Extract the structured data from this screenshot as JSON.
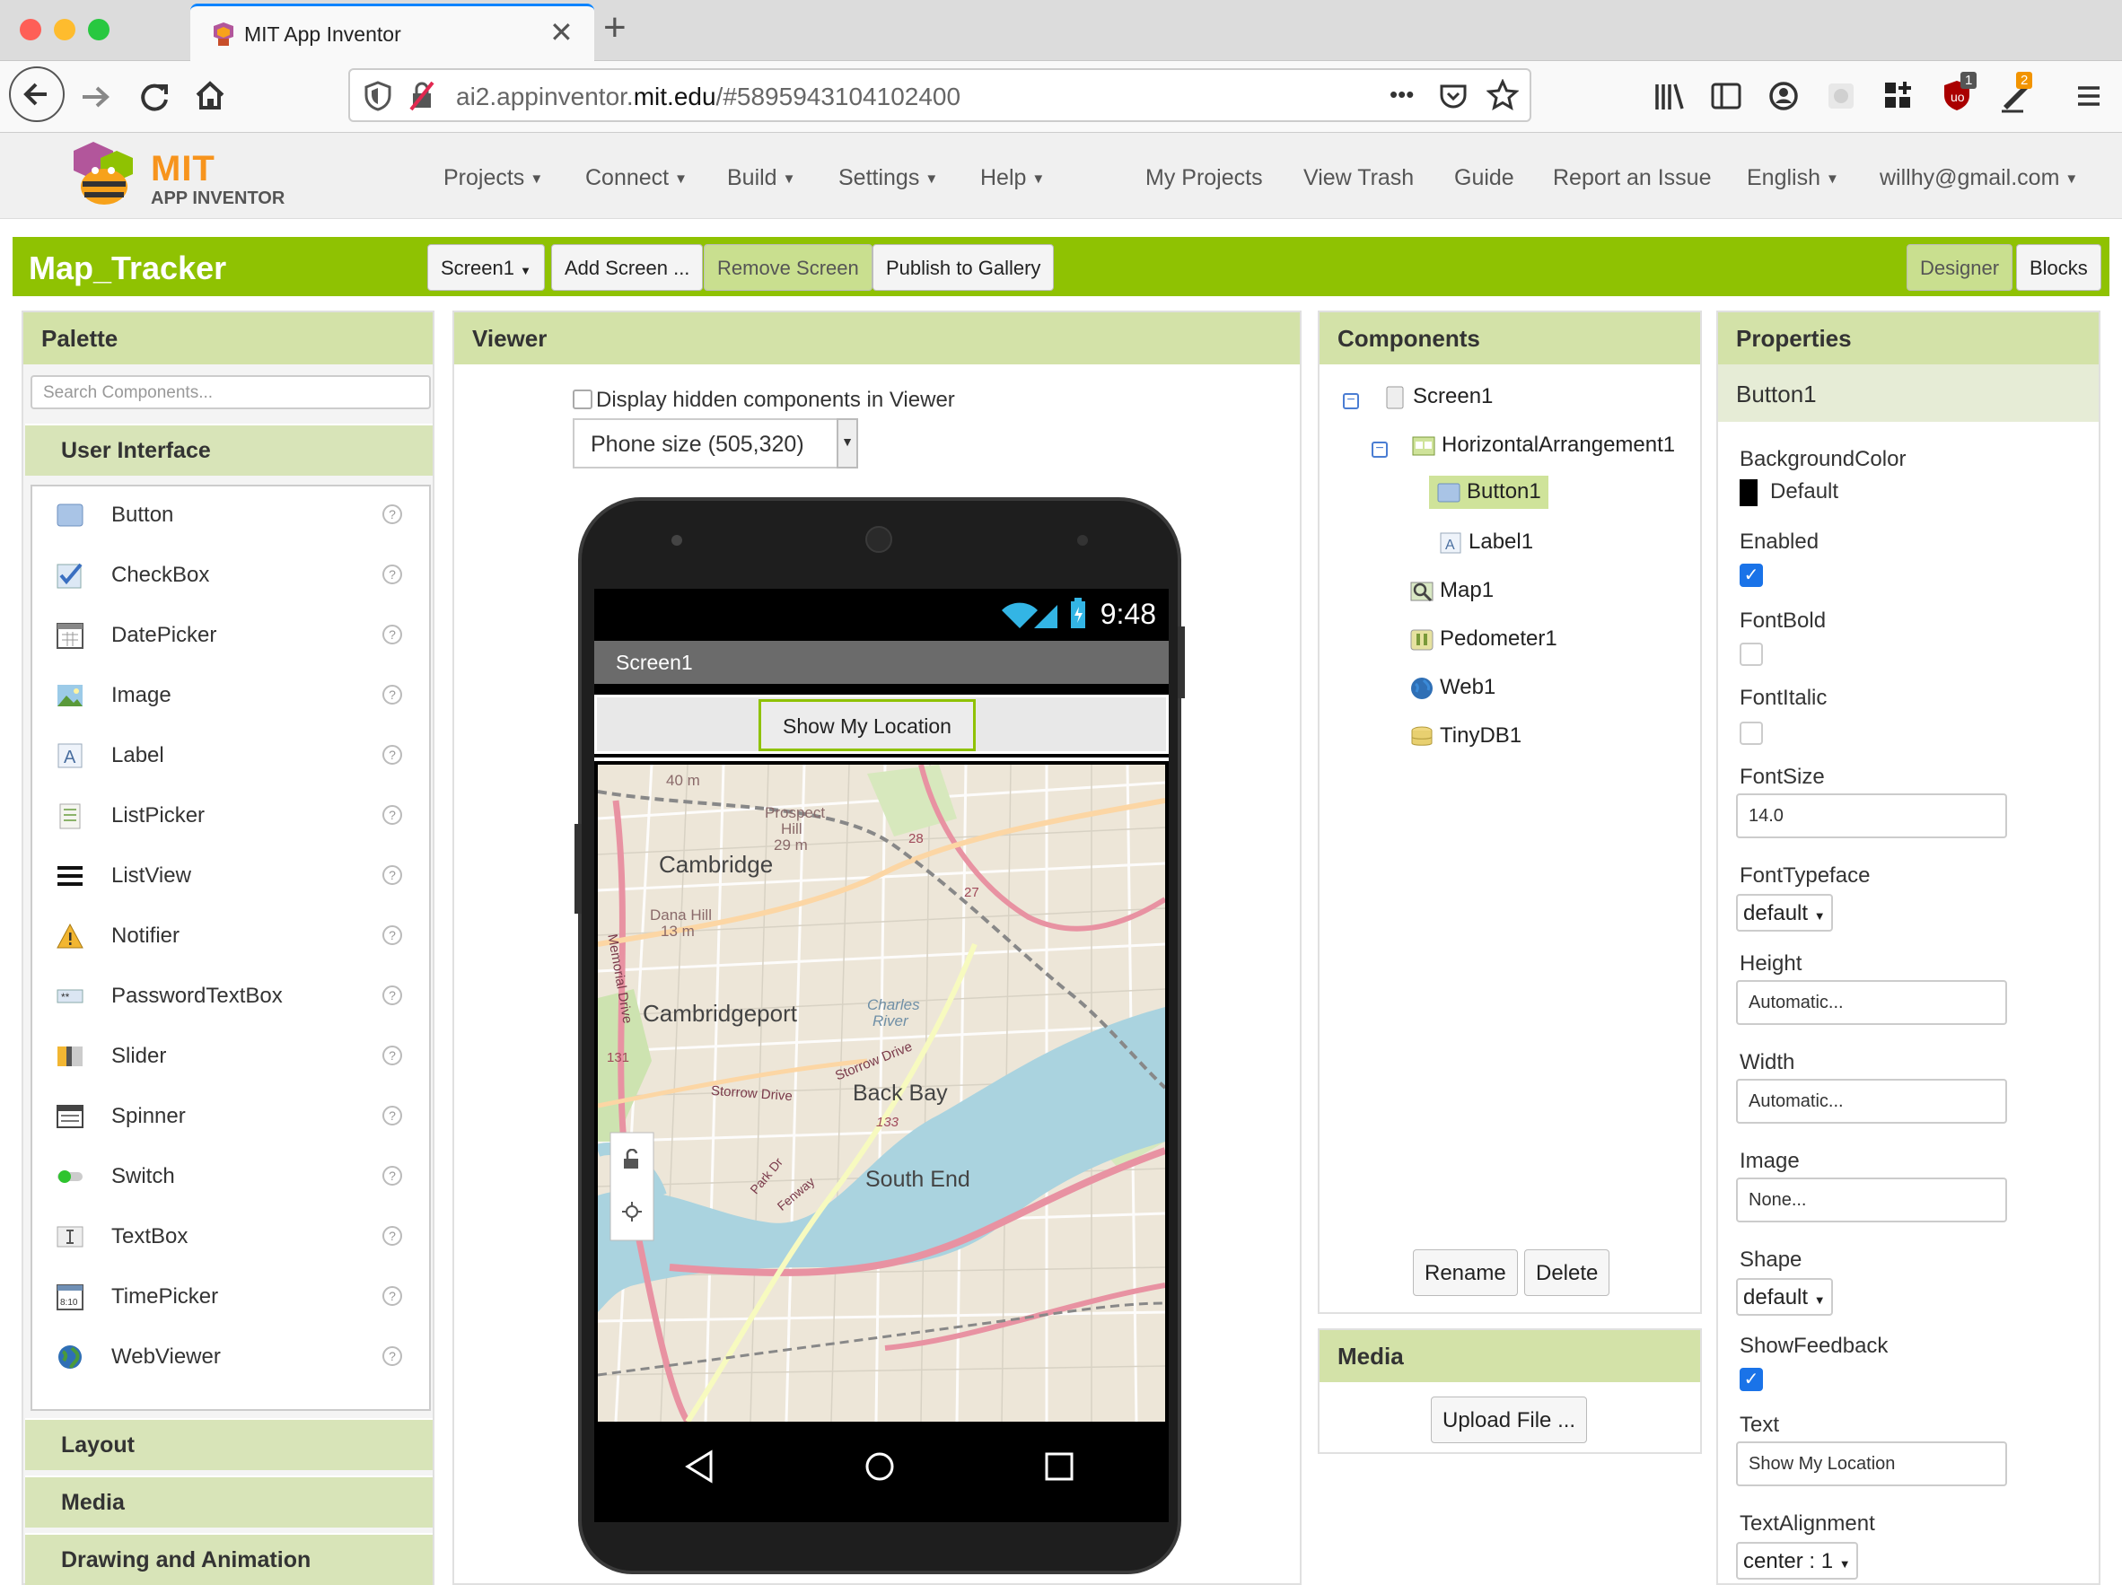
{
  "browser": {
    "tab_title": "MIT App Inventor",
    "url_prefix": "ai2.appinventor.",
    "url_host": "mit.edu",
    "url_path": "/#5895943104102400",
    "url_dots": "•••",
    "badge_1": "1",
    "badge_2": "2"
  },
  "header": {
    "logo_mit": "MIT",
    "logo_sub": "APP INVENTOR",
    "menus": [
      "Projects",
      "Connect",
      "Build",
      "Settings",
      "Help"
    ],
    "links": [
      "My Projects",
      "View Trash",
      "Guide",
      "Report an Issue"
    ],
    "language": "English",
    "user": "willhy@gmail.com"
  },
  "project": {
    "name": "Map_Tracker",
    "screen_select": "Screen1",
    "add_screen": "Add Screen ...",
    "remove_screen": "Remove Screen",
    "publish": "Publish to Gallery",
    "designer": "Designer",
    "blocks": "Blocks"
  },
  "palette": {
    "title": "Palette",
    "search_placeholder": "Search Components...",
    "category_open": "User Interface",
    "items": [
      "Button",
      "CheckBox",
      "DatePicker",
      "Image",
      "Label",
      "ListPicker",
      "ListView",
      "Notifier",
      "PasswordTextBox",
      "Slider",
      "Spinner",
      "Switch",
      "TextBox",
      "TimePicker",
      "WebViewer"
    ],
    "help": "?",
    "categories_closed": [
      "Layout",
      "Media",
      "Drawing and Animation"
    ]
  },
  "viewer": {
    "title": "Viewer",
    "hidden_label": "Display hidden components in Viewer",
    "phone_size": "Phone size (505,320)",
    "time": "9:48",
    "screen_title": "Screen1",
    "button_text": "Show My Location",
    "map_labels": {
      "cambridge": "Cambridge",
      "cambridgeport": "Cambridgeport",
      "back_bay": "Back Bay",
      "south_end": "South End",
      "prospect_hill": "Prospect",
      "prospect_hill2": "Hill",
      "prospect_m": "29 m",
      "dana_hill": "Dana Hill",
      "dana_m": "13 m",
      "m40": "40 m",
      "charles": "Charles",
      "river": "River",
      "storrow1": "Storrow Drive",
      "storrow2": "Storrow Drive",
      "memorial": "Memorial Drive",
      "park_dr": "Park Dr",
      "fenway": "Fenway",
      "r131": "131",
      "r133": "133",
      "r28": "28",
      "r27": "27"
    }
  },
  "components": {
    "title": "Components",
    "tree": {
      "screen": "Screen1",
      "harr": "HorizontalArrangement1",
      "button": "Button1",
      "label": "Label1",
      "map": "Map1",
      "pedometer": "Pedometer1",
      "web": "Web1",
      "tinydb": "TinyDB1"
    },
    "rename": "Rename",
    "delete": "Delete"
  },
  "media": {
    "title": "Media",
    "upload": "Upload File ..."
  },
  "properties": {
    "title": "Properties",
    "component": "Button1",
    "bgcolor_label": "BackgroundColor",
    "bgcolor_value": "Default",
    "enabled_label": "Enabled",
    "enabled": true,
    "fontbold_label": "FontBold",
    "fontbold": false,
    "fontitalic_label": "FontItalic",
    "fontitalic": false,
    "fontsize_label": "FontSize",
    "fontsize_value": "14.0",
    "fonttypeface_label": "FontTypeface",
    "fonttypeface_value": "default",
    "height_label": "Height",
    "height_value": "Automatic...",
    "width_label": "Width",
    "width_value": "Automatic...",
    "image_label": "Image",
    "image_value": "None...",
    "shape_label": "Shape",
    "shape_value": "default",
    "showfeedback_label": "ShowFeedback",
    "showfeedback": true,
    "text_label": "Text",
    "text_value": "Show My Location",
    "textalign_label": "TextAlignment",
    "textalign_value": "center : 1"
  },
  "colors": {
    "green_bar": "#8fc202",
    "panel_header": "#d3e2a8",
    "checkbox_blue": "#1a73e8"
  }
}
